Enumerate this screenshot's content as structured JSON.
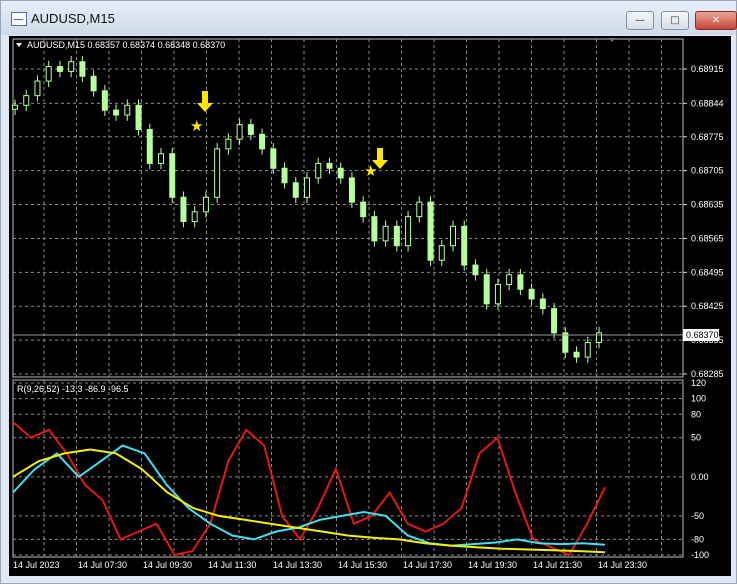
{
  "window": {
    "title": "AUDUSD,M15",
    "minimize_icon": "minimize-icon",
    "restore_icon": "restore-icon",
    "close_icon": "close-icon"
  },
  "chart": {
    "header": "AUDUSD,M15  0.68357 0.68374 0.68348 0.68370",
    "current_price_label": "0.68370",
    "price_ticks": [
      "0.68915",
      "0.68844",
      "0.68775",
      "0.68705",
      "0.68635",
      "0.68565",
      "0.68495",
      "0.68425",
      "0.68355",
      "0.68285"
    ],
    "time_ticks": [
      "14 Jul 2023",
      "14 Jul 07:30",
      "14 Jul 09:30",
      "14 Jul 11:30",
      "14 Jul 13:30",
      "14 Jul 15:30",
      "14 Jul 17:30",
      "14 Jul 19:30",
      "14 Jul 21:30",
      "14 Jul 23:30"
    ],
    "colors": {
      "background": "#000000",
      "grid": "#a8a8a8",
      "candle": "#b6ff9a",
      "signal": "#ffe600"
    }
  },
  "indicator": {
    "label": "R(9,26,52) -13.3 -86.9 -96.5",
    "ticks": [
      "120",
      "100",
      "80",
      "50",
      "0.00",
      "-50",
      "-80",
      "-100"
    ],
    "colors": {
      "red": "#e01818",
      "cyan": "#40e0f0",
      "yellow": "#f5f000"
    }
  },
  "chart_data": {
    "type": "line",
    "title": "AUDUSD,M15",
    "ylim": [
      0.68285,
      0.68915
    ],
    "candles_close_approx": [
      0.6884,
      0.6886,
      0.6889,
      0.6892,
      0.6891,
      0.6893,
      0.689,
      0.6887,
      0.6883,
      0.6882,
      0.6884,
      0.6879,
      0.6872,
      0.6874,
      0.6865,
      0.686,
      0.6862,
      0.6865,
      0.6875,
      0.6877,
      0.688,
      0.6878,
      0.6875,
      0.6871,
      0.6868,
      0.6865,
      0.6869,
      0.6872,
      0.6871,
      0.6869,
      0.6864,
      0.6861,
      0.6856,
      0.6859,
      0.6855,
      0.6861,
      0.6864,
      0.6852,
      0.6855,
      0.6859,
      0.6851,
      0.6849,
      0.6843,
      0.6847,
      0.6849,
      0.6846,
      0.6844,
      0.6842,
      0.6837,
      0.6833,
      0.6832,
      0.6835,
      0.6837
    ],
    "series": [
      {
        "name": "R(9)",
        "values": [
          70,
          50,
          60,
          30,
          -10,
          -30,
          -80,
          -70,
          -60,
          -100,
          -95,
          -60,
          20,
          60,
          40,
          -50,
          -80,
          -40,
          10,
          -60,
          -50,
          -20,
          -60,
          -70,
          -60,
          -40,
          30,
          50,
          -20,
          -80,
          -90,
          -100,
          -60,
          -13.3
        ]
      },
      {
        "name": "R(26)",
        "values": [
          -20,
          10,
          30,
          0,
          20,
          40,
          30,
          -10,
          -40,
          -60,
          -75,
          -80,
          -70,
          -65,
          -55,
          -50,
          -45,
          -50,
          -75,
          -85,
          -88,
          -86,
          -84,
          -80,
          -85,
          -86,
          -85,
          -86.9
        ]
      },
      {
        "name": "R(52)",
        "values": [
          0,
          20,
          30,
          35,
          30,
          10,
          -20,
          -40,
          -50,
          -55,
          -60,
          -65,
          -70,
          -75,
          -78,
          -80,
          -85,
          -88,
          -90,
          -92,
          -93,
          -94,
          -95,
          -96.5
        ]
      }
    ]
  }
}
